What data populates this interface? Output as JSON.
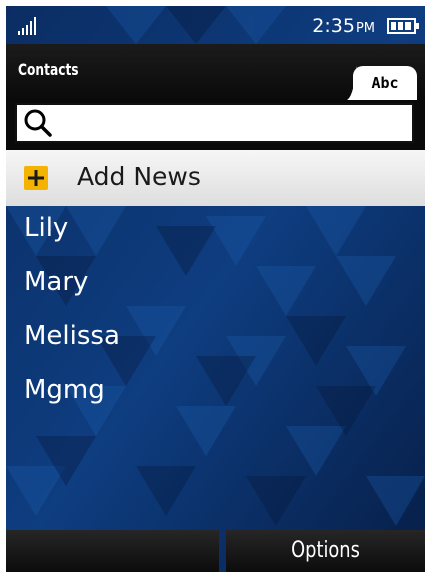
{
  "status_bar": {
    "time": "2:35",
    "ampm": "PM",
    "signal_icon": "signal-strength-icon",
    "battery_icon": "battery-icon"
  },
  "header": {
    "title": "Contacts",
    "tab_label": "Abc"
  },
  "search": {
    "placeholder": "",
    "value": "",
    "icon": "search-icon"
  },
  "add_news": {
    "label": "Add News",
    "icon": "plus-icon"
  },
  "contacts": [
    {
      "name": "Lily"
    },
    {
      "name": "Mary"
    },
    {
      "name": "Melissa"
    },
    {
      "name": "Mgmg"
    }
  ],
  "softkeys": {
    "left": "",
    "right": "Options"
  },
  "colors": {
    "background": "#0c2f63",
    "accent": "#f3b300",
    "bar": "#0a0a0a"
  }
}
